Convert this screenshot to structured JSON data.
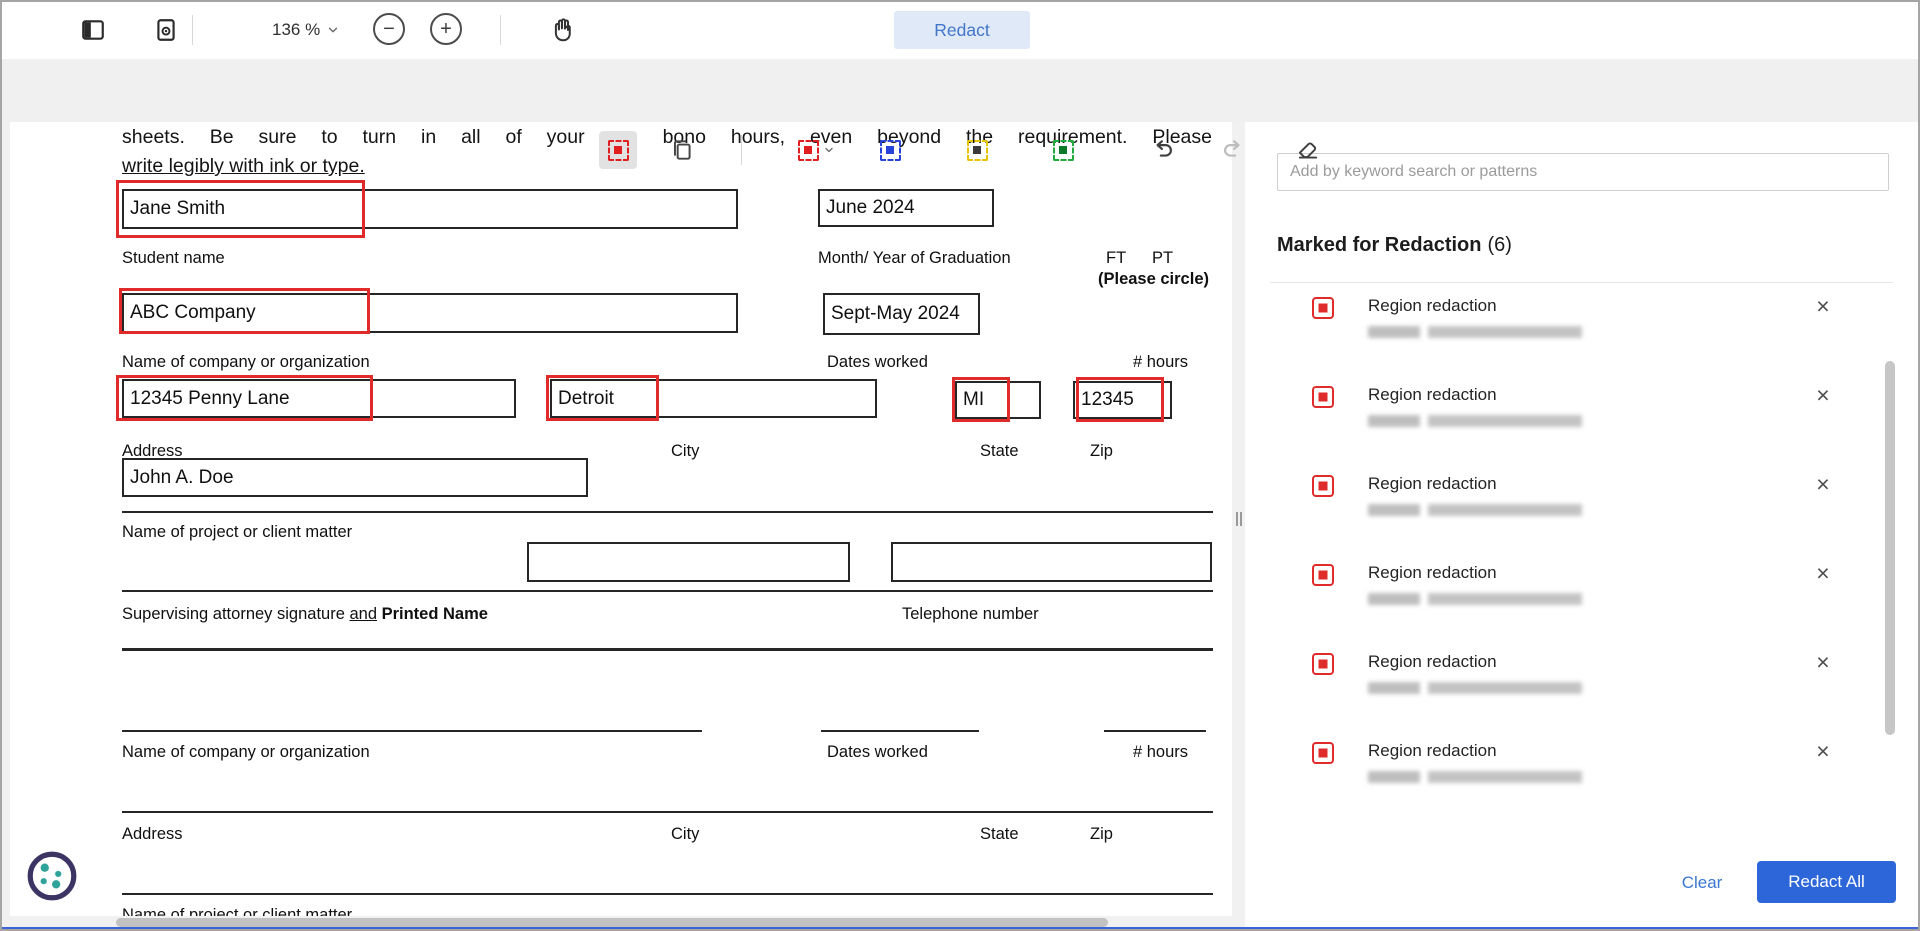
{
  "window": {
    "accent_blue": "#2d66d9",
    "redaction_red": "#e02b2b"
  },
  "top_toolbar": {
    "zoom_value": "136 %",
    "redact_button": "Redact"
  },
  "doc": {
    "para_line1": "sheets. Be sure to turn in all of your pro bono hours, even beyond the requirement. Please",
    "para_line2": "write legibly with ink or type.",
    "student_name_value": "Jane Smith",
    "student_name_label": "Student name",
    "grad_value": "June 2024",
    "grad_label": "Month/ Year of Graduation",
    "ft_label": "FT",
    "pt_label": "PT",
    "please_circle": "(Please circle)",
    "company_value": "ABC Company",
    "company_label": "Name of company or organization",
    "dates_value": "Sept-May 2024",
    "dates_label": "Dates worked",
    "hours_label": "# hours",
    "address_value": "12345 Penny Lane",
    "address_label": "Address",
    "city_value": "Detroit",
    "city_label": "City",
    "state_value": "MI",
    "state_label": "State",
    "zip_value": "12345",
    "zip_label": "Zip",
    "project_value": "John A. Doe",
    "project_label": "Name of project or client matter",
    "attorney_prefix": "Supervising attorney signature ",
    "attorney_and": "and",
    "attorney_bold": " Printed Name",
    "telephone_label": "Telephone number",
    "section2": {
      "company_label": "Name of company or organization",
      "dates_label": "Dates worked",
      "hours_label": "# hours",
      "address_label": "Address",
      "city_label": "City",
      "state_label": "State",
      "zip_label": "Zip",
      "project_label": "Name of project or client matter"
    }
  },
  "sidebar": {
    "search_placeholder": "Add by keyword search or patterns",
    "heading": "Marked for Redaction",
    "count": "(6)",
    "items": [
      {
        "title": "Region redaction"
      },
      {
        "title": "Region redaction"
      },
      {
        "title": "Region redaction"
      },
      {
        "title": "Region redaction"
      },
      {
        "title": "Region redaction"
      },
      {
        "title": "Region redaction"
      }
    ],
    "clear_button": "Clear",
    "redact_all_button": "Redact All"
  }
}
